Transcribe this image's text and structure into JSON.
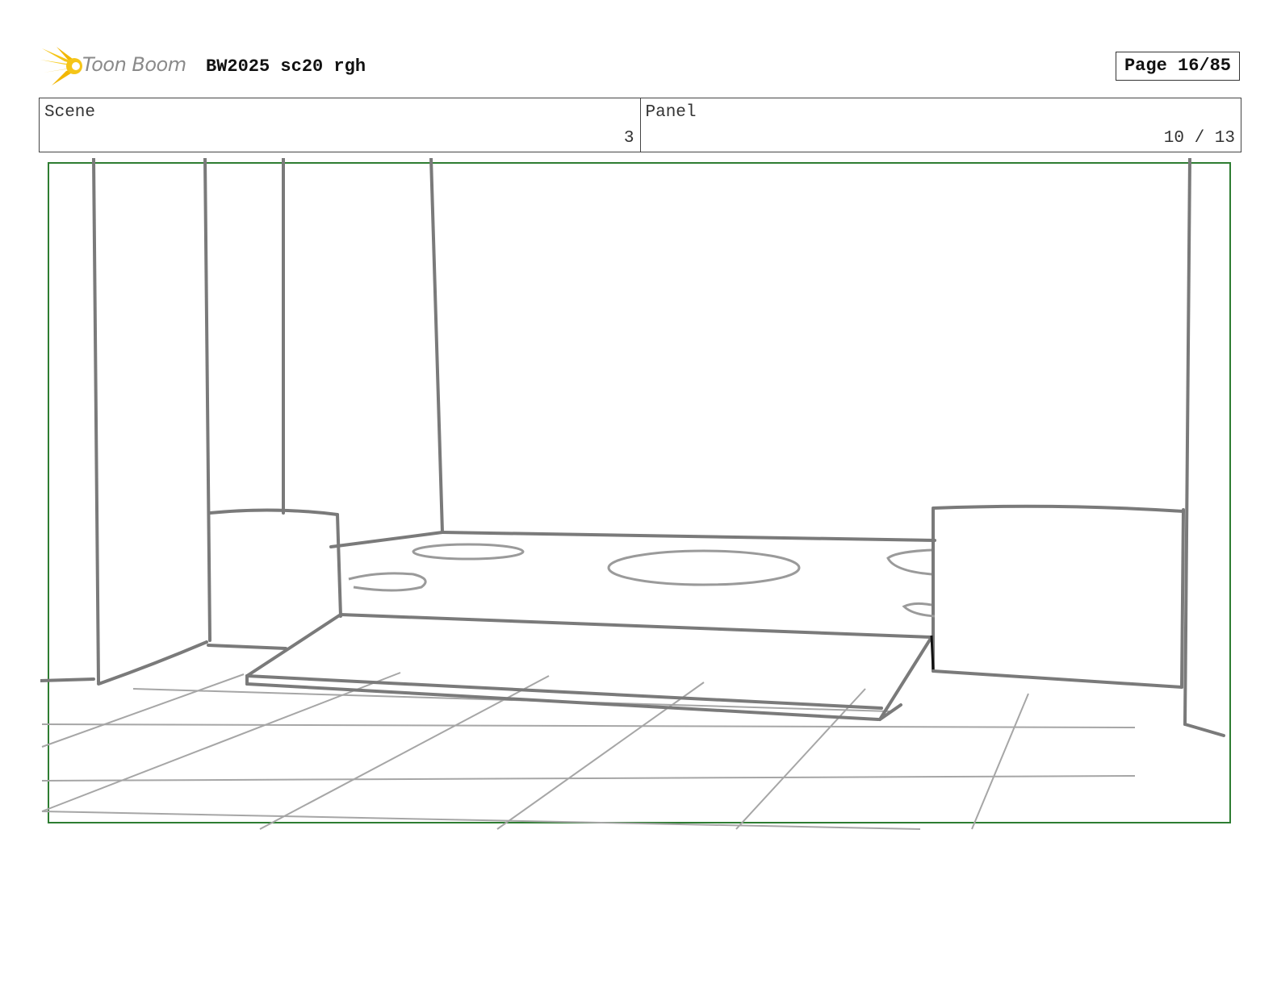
{
  "header": {
    "logo_text": "Toon Boom",
    "project_title": "BW2025 sc20 rgh",
    "page_label": "Page 16/85"
  },
  "info": {
    "scene_label": "Scene",
    "scene_value": "3",
    "panel_label": "Panel",
    "panel_value": "10 / 13"
  },
  "colors": {
    "frame_border": "#2e7d32",
    "sketch_dark": "#7a7a7a",
    "sketch_light": "#a0a0a0",
    "logo_yellow": "#f5c518"
  }
}
